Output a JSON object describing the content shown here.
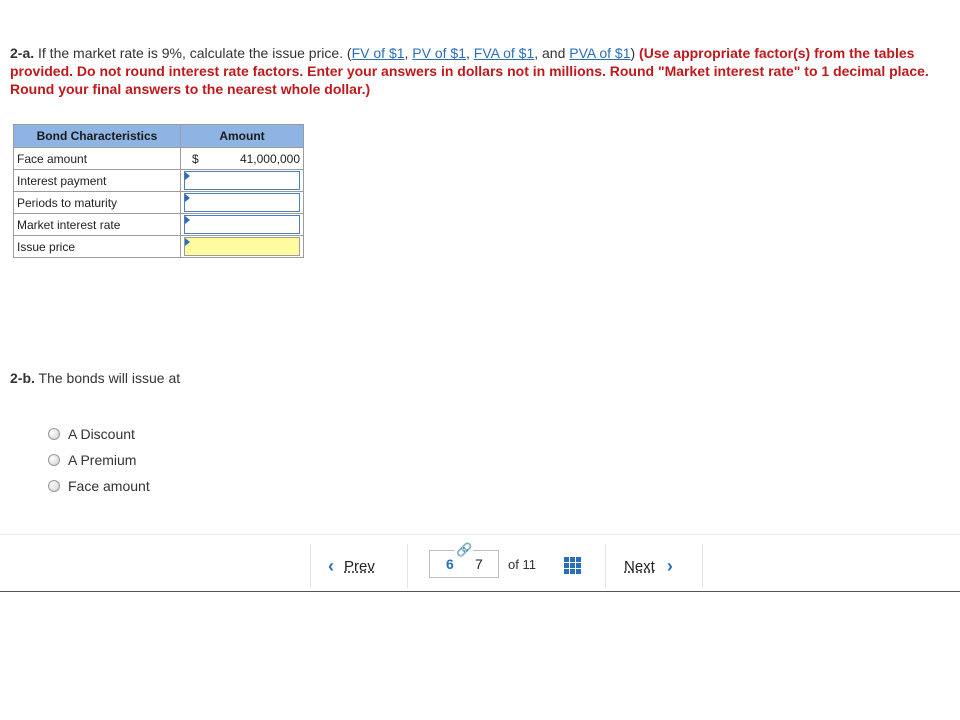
{
  "question_2a": {
    "number": "2-a.",
    "text": " If the market rate is 9%, calculate the issue price. (",
    "links": [
      "FV of $1",
      "PV of $1",
      "FVA of $1",
      "PVA of $1"
    ],
    "sep_comma": ", ",
    "sep_and": ", and ",
    "close_paren": ")",
    "instructions": " (Use appropriate factor(s) from the tables provided. Do not round interest rate factors. Enter your answers in dollars not in millions. Round \"Market interest rate\" to 1 decimal place. Round your final answers to the nearest whole dollar.)"
  },
  "table": {
    "headers": [
      "Bond Characteristics",
      "Amount"
    ],
    "rows": [
      {
        "label": "Face amount",
        "prefix": "$",
        "value": "41,000,000"
      },
      {
        "label": "Interest payment",
        "value": ""
      },
      {
        "label": "Periods to maturity",
        "value": ""
      },
      {
        "label": "Market interest rate",
        "value": ""
      },
      {
        "label": "Issue price",
        "value": ""
      }
    ]
  },
  "question_2b": {
    "number": "2-b.",
    "text": " The bonds will issue at",
    "options": [
      "A Discount",
      "A Premium",
      "Face amount"
    ]
  },
  "navigation": {
    "prev_label": "Prev",
    "current_page": "6",
    "next_page": "7",
    "of_total": "of 11",
    "next_label": "Next",
    "link_icon": "link-icon",
    "grid_icon": "grid-icon"
  },
  "colors": {
    "link": "#2a6ebb",
    "instruction_red": "#c0191c",
    "header_blue": "#8eb4e3",
    "answer_yellow": "#fffca0"
  }
}
